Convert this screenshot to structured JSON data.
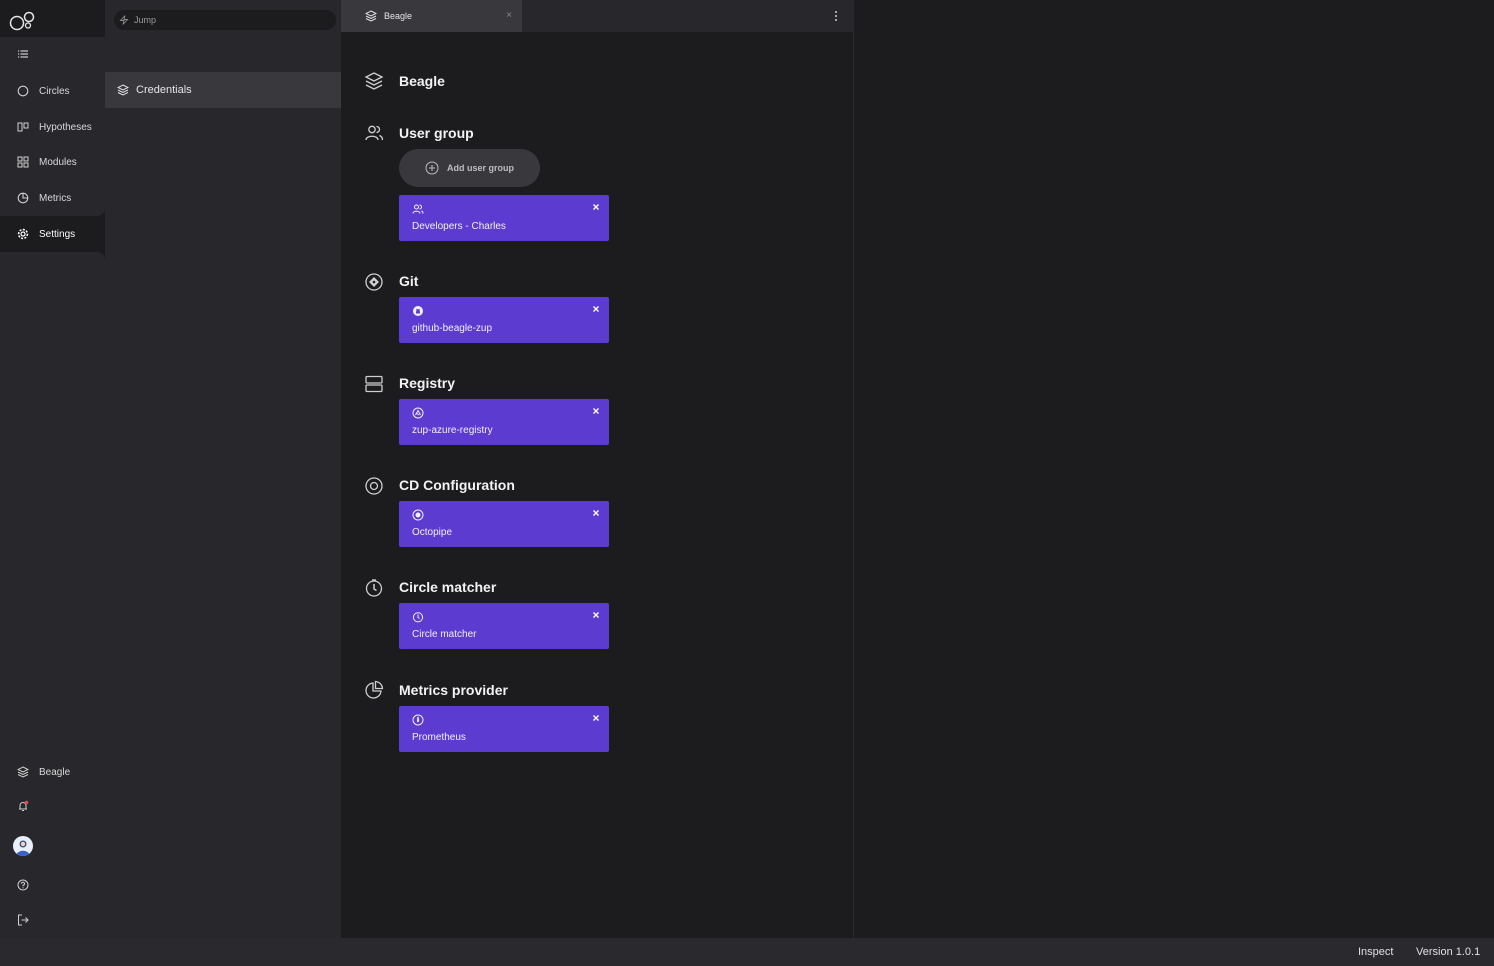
{
  "sidebar": {
    "nav": [
      {
        "label": "Circles",
        "icon": "circle-icon"
      },
      {
        "label": "Hypotheses",
        "icon": "hypotheses-icon"
      },
      {
        "label": "Modules",
        "icon": "modules-icon"
      },
      {
        "label": "Metrics",
        "icon": "metrics-icon"
      },
      {
        "label": "Settings",
        "icon": "gear-icon"
      }
    ],
    "workspace_label": "Beagle"
  },
  "search": {
    "placeholder": "Jump"
  },
  "settings_menu": {
    "credentials_label": "Credentials"
  },
  "tab": {
    "label": "Beagle",
    "close": "×"
  },
  "workspace": {
    "title": "Beagle"
  },
  "sections": {
    "user_group": {
      "title": "User group",
      "add_label": "Add user group",
      "card": "Developers - Charles"
    },
    "git": {
      "title": "Git",
      "card": "github-beagle-zup"
    },
    "registry": {
      "title": "Registry",
      "card": "zup-azure-registry"
    },
    "cd": {
      "title": "CD Configuration",
      "card": "Octopipe"
    },
    "circle_matcher": {
      "title": "Circle matcher",
      "card": "Circle matcher"
    },
    "metrics_provider": {
      "title": "Metrics provider",
      "card": "Prometheus"
    }
  },
  "footer": {
    "inspect": "Inspect",
    "version": "Version 1.0.1"
  },
  "colors": {
    "accent": "#5c3bd1",
    "background": "#1c1c1f",
    "panel": "#28282c",
    "notification_dot": "#e5484d"
  }
}
